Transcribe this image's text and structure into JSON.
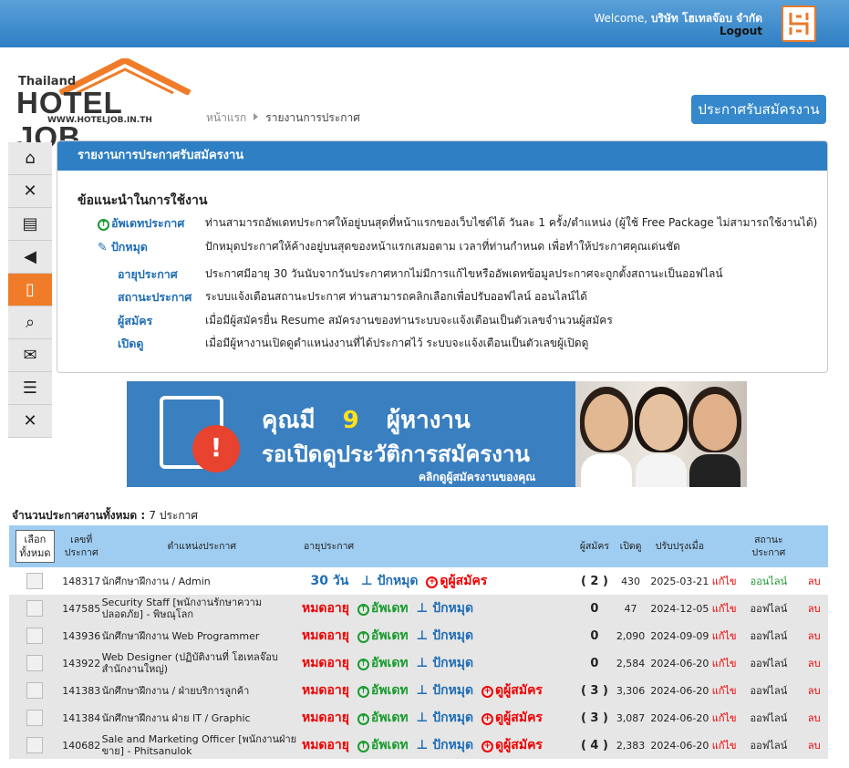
{
  "header": {
    "welcome": "Welcome,",
    "company": "บริษัท โฮเทลจ๊อบ จำกัด",
    "logout": "Logout"
  },
  "logo": {
    "line1": "Thailand",
    "line2": "HOTEL JOB",
    "line3": "WWW.HOTELJOB.IN.TH"
  },
  "breadcrumb": {
    "home": "หน้าแรก",
    "current": "รายงานการประกาศ"
  },
  "cta_button": "ประกาศรับสมัครงาน",
  "sidebar": {
    "items": [
      {
        "icon": "home-icon"
      },
      {
        "icon": "tools-icon"
      },
      {
        "icon": "newspaper-icon"
      },
      {
        "icon": "megaphone-icon"
      },
      {
        "icon": "document-icon",
        "active": true
      },
      {
        "icon": "search-doc-icon"
      },
      {
        "icon": "mail-icon"
      },
      {
        "icon": "list-edit-icon"
      },
      {
        "icon": "settings-icon"
      }
    ]
  },
  "panel": {
    "title": "รายงานการประกาศรับสมัครงาน",
    "guide_title": "ข้อแนะนำในการใช้งาน",
    "guides": [
      {
        "icon": "up-arrow-icon",
        "term": "อัพเดทประกาศ",
        "desc": "ท่านสามารถอัพเดทประกาศให้อยู่บนสุดที่หน้าแรกของเว็บไซต์ได้ วันละ 1 ครั้ง/ตำแหน่ง (ผู้ใช้ Free Package ไม่สามารถใช้งานได้)"
      },
      {
        "icon": "pin-icon",
        "term": "ปักหมุด",
        "desc": "ปักหมุดประกาศให้ค้างอยู่บนสุดของหน้าแรกเสมอตาม เวลาที่ท่านกำหนด เพื่อทำให้ประกาศคุณเด่นชัด"
      },
      {
        "icon": "",
        "term": "อายุประกาศ",
        "desc": "ประกาศมีอายุ 30 วันนับจากวันประกาศหากไม่มีการแก้ไขหรืออัพเดทข้อมูลประกาศจะถูกตั้งสถานะเป็นออฟไลน์"
      },
      {
        "icon": "",
        "term": "สถานะประกาศ",
        "desc": "ระบบแจ้งเตือนสถานะประกาศ ท่านสามารถคลิกเลือกเพื่อปรับออฟไลน์ ออนไลน์ได้"
      },
      {
        "icon": "",
        "term": "ผู้สมัคร",
        "desc": "เมื่อมีผู้สมัครยื่น Resume สมัครงานของท่านระบบจะแจ้งเตือนเป็นตัวเลขจำนวนผู้สมัคร"
      },
      {
        "icon": "",
        "term": "เปิดดู",
        "desc": "เมื่อมีผู้หางานเปิดดูตำแหน่งงานที่ได้ประกาศไว้ ระบบจะแจ้งเตือนเป็นตัวเลขผู้เปิดดู"
      }
    ]
  },
  "banner": {
    "pre": "คุณมี",
    "count": "9",
    "post": "ผู้หางาน",
    "line2": "รอเปิดดูประวัติการสมัครงาน",
    "line3": "คลิกดูผู้สมัครงานของคุณ"
  },
  "summary": {
    "label": "จำนวนประกาศงานทั้งหมด :",
    "value": "7 ประกาศ"
  },
  "table": {
    "headers": {
      "select_all": "เลือก\nทั้งหมด",
      "id": "เลขที่\nประกาศ",
      "position": "ตำแหน่งประกาศ",
      "age": "อายุประกาศ",
      "applicants": "ผู้สมัคร",
      "views": "เปิดดู",
      "updated": "ปรับปรุงเมื่อ",
      "status": "สถานะ\nประกาศ"
    },
    "labels": {
      "expired": "หมดอายุ",
      "update": "อัพเดท",
      "pin": "ปักหมุด",
      "view_applicants": "ดูผู้สมัคร",
      "edit": "แก้ไข",
      "delete": "ลบ",
      "online": "ออนไลน์",
      "offline": "ออฟไลน์"
    },
    "rows": [
      {
        "id": "148317",
        "position": "นักศึกษาฝึกงาน / Admin",
        "age": "30 วัน",
        "expired": false,
        "can_update": false,
        "applicants": "( 2 )",
        "views": "430",
        "updated": "2025-03-21",
        "status": "ออนไลน์",
        "online": true
      },
      {
        "id": "147585",
        "position": "Security Staff [พนักงานรักษาความปลอดภัย] - พิษณุโลก",
        "age": "",
        "expired": true,
        "can_update": true,
        "applicants": "0",
        "views": "47",
        "updated": "2024-12-05",
        "status": "ออฟไลน์",
        "online": false
      },
      {
        "id": "143936",
        "position": "นักศึกษาฝึกงาน Web Programmer",
        "age": "",
        "expired": true,
        "can_update": true,
        "applicants": "0",
        "views": "2,090",
        "updated": "2024-09-09",
        "status": "ออฟไลน์",
        "online": false
      },
      {
        "id": "143922",
        "position": "Web Designer (ปฏิบัติงานที่ โฮเทลจ๊อบ สำนักงานใหญ่)",
        "age": "",
        "expired": true,
        "can_update": true,
        "applicants": "0",
        "views": "2,584",
        "updated": "2024-06-20",
        "status": "ออฟไลน์",
        "online": false
      },
      {
        "id": "141383",
        "position": "นักศึกษาฝึกงาน / ฝ่ายบริการลูกค้า",
        "age": "",
        "expired": true,
        "can_update": true,
        "applicants": "( 3 )",
        "views": "3,306",
        "updated": "2024-06-20",
        "status": "ออฟไลน์",
        "online": false
      },
      {
        "id": "141384",
        "position": "นักศึกษาฝึกงาน ฝ่าย IT / Graphic",
        "age": "",
        "expired": true,
        "can_update": true,
        "applicants": "( 3 )",
        "views": "3,087",
        "updated": "2024-06-20",
        "status": "ออฟไลน์",
        "online": false
      },
      {
        "id": "140682",
        "position": "Sale and Marketing Officer [พนักงานฝ่ายขาย] - Phitsanulok",
        "age": "",
        "expired": true,
        "can_update": true,
        "applicants": "( 4 )",
        "views": "2,383",
        "updated": "2024-06-20",
        "status": "ออฟไลน์",
        "online": false
      }
    ]
  }
}
